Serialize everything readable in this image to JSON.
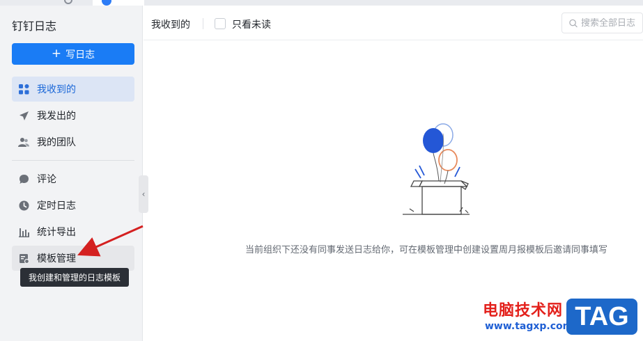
{
  "app": {
    "title": "钉钉日志"
  },
  "sidebar": {
    "write_label": "写日志",
    "items": [
      {
        "label": "我收到的",
        "icon": "grid-icon",
        "active": true
      },
      {
        "label": "我发出的",
        "icon": "send-icon",
        "active": false
      },
      {
        "label": "我的团队",
        "icon": "team-icon",
        "active": false
      },
      {
        "label": "评论",
        "icon": "comment-icon",
        "active": false
      },
      {
        "label": "定时日志",
        "icon": "clock-icon",
        "active": false
      },
      {
        "label": "统计导出",
        "icon": "bar-chart-icon",
        "active": false
      },
      {
        "label": "模板管理",
        "icon": "template-icon",
        "active": false
      }
    ],
    "tooltip": "我创建和管理的日志模板"
  },
  "toolbar": {
    "title": "我收到的",
    "unread_only_label": "只看未读",
    "unread_only_checked": false,
    "search_placeholder": "搜索全部日志"
  },
  "empty_state": {
    "message": "当前组织下还没有同事发送日志给你，可在模板管理中创建设置周月报模板后邀请同事填写"
  },
  "watermark": {
    "site_name": "电脑技术网",
    "url": "www.tagxp.com",
    "tag": "TAG"
  },
  "colors": {
    "primary": "#1a7cf5",
    "active_bg": "#dce5f5",
    "active_text": "#1a67d8",
    "sidebar_bg": "#f2f3f5",
    "annotation_arrow": "#d42020"
  }
}
